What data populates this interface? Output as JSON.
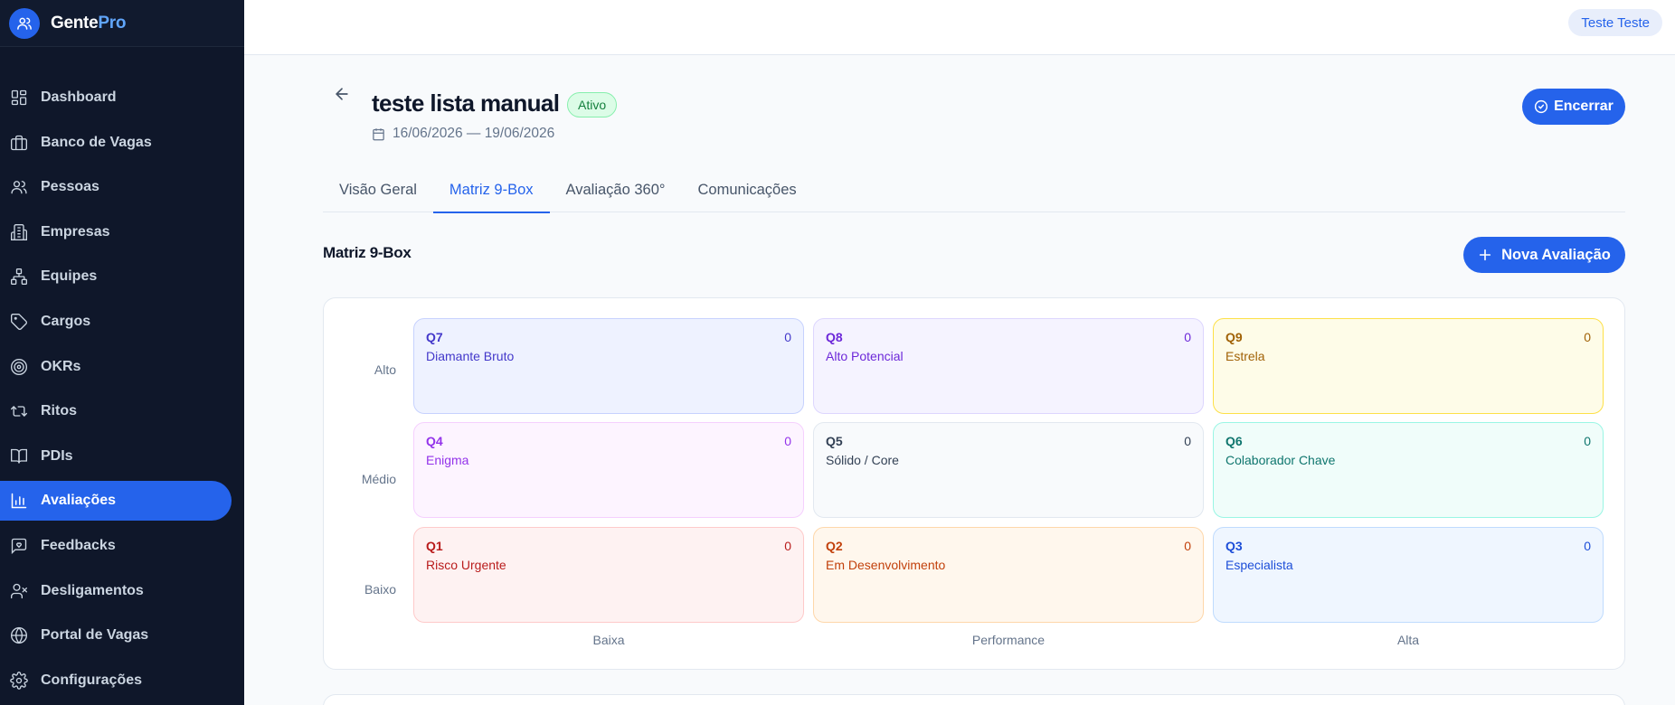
{
  "brand": {
    "name_part1": "Gente",
    "name_part2": "Pro"
  },
  "sidebar": {
    "items": [
      {
        "label": "Dashboard",
        "icon": "dashboard-icon"
      },
      {
        "label": "Banco de Vagas",
        "icon": "briefcase-icon"
      },
      {
        "label": "Pessoas",
        "icon": "users-icon"
      },
      {
        "label": "Empresas",
        "icon": "building-icon"
      },
      {
        "label": "Equipes",
        "icon": "network-icon"
      },
      {
        "label": "Cargos",
        "icon": "tag-icon"
      },
      {
        "label": "OKRs",
        "icon": "target-icon"
      },
      {
        "label": "Ritos",
        "icon": "repeat-icon"
      },
      {
        "label": "PDIs",
        "icon": "book-icon"
      },
      {
        "label": "Avaliações",
        "icon": "bar-chart-icon",
        "active": true
      },
      {
        "label": "Feedbacks",
        "icon": "message-heart-icon"
      },
      {
        "label": "Desligamentos",
        "icon": "user-x-icon"
      },
      {
        "label": "Portal de Vagas",
        "icon": "globe-icon"
      },
      {
        "label": "Configurações",
        "icon": "gear-icon"
      }
    ]
  },
  "topbar": {
    "user_name": "Teste Teste"
  },
  "header": {
    "title": "teste lista manual",
    "status": "Ativo",
    "date_range": "16/06/2026 — 19/06/2026",
    "close_button": "Encerrar"
  },
  "tabs": [
    {
      "label": "Visão Geral"
    },
    {
      "label": "Matriz 9-Box",
      "active": true
    },
    {
      "label": "Avaliação 360°"
    },
    {
      "label": "Comunicações"
    }
  ],
  "section": {
    "title": "Matriz 9-Box",
    "new_button": "Nova Avaliação"
  },
  "matrix": {
    "row_labels": [
      "Alto",
      "Médio",
      "Baixo"
    ],
    "column_labels": [
      "Baixa",
      "Performance",
      "Alta"
    ],
    "cells": [
      {
        "code": "Q7",
        "name": "Diamante Bruto",
        "count": "0",
        "bg": "#eef2ff",
        "border": "#c7d2fe",
        "color": "#4338ca"
      },
      {
        "code": "Q8",
        "name": "Alto Potencial",
        "count": "0",
        "bg": "#f5f3ff",
        "border": "#ddd6fe",
        "color": "#6d28d9"
      },
      {
        "code": "Q9",
        "name": "Estrela",
        "count": "0",
        "bg": "#fefce8",
        "border": "#fde047",
        "color": "#a16207"
      },
      {
        "code": "Q4",
        "name": "Enigma",
        "count": "0",
        "bg": "#fdf4ff",
        "border": "#f5d0fe",
        "color": "#9333ea"
      },
      {
        "code": "Q5",
        "name": "Sólido / Core",
        "count": "0",
        "bg": "#f8fafc",
        "border": "#e2e8f0",
        "color": "#334155"
      },
      {
        "code": "Q6",
        "name": "Colaborador Chave",
        "count": "0",
        "bg": "#f0fdfa",
        "border": "#99f6e4",
        "color": "#0f766e"
      },
      {
        "code": "Q1",
        "name": "Risco Urgente",
        "count": "0",
        "bg": "#fef2f2",
        "border": "#fecaca",
        "color": "#b91c1c"
      },
      {
        "code": "Q2",
        "name": "Em Desenvolvimento",
        "count": "0",
        "bg": "#fff7ed",
        "border": "#fed7aa",
        "color": "#c2410c"
      },
      {
        "code": "Q3",
        "name": "Especialista",
        "count": "0",
        "bg": "#eff6ff",
        "border": "#bfdbfe",
        "color": "#1d4ed8"
      }
    ]
  }
}
